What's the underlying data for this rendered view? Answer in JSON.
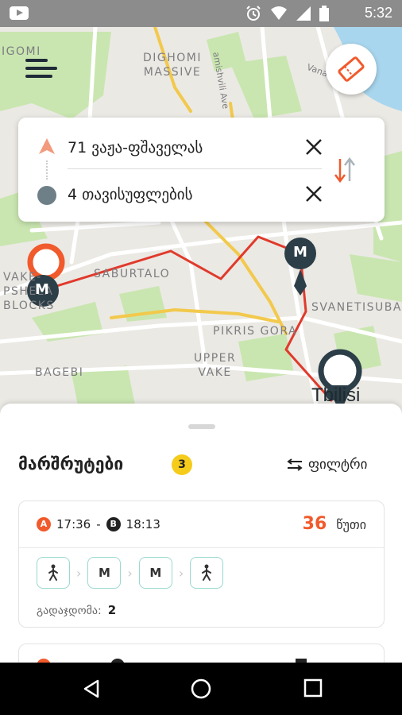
{
  "status_bar": {
    "time": "5:32",
    "icons": [
      "youtube-icon",
      "alarm-icon",
      "wifi-icon",
      "signal-icon",
      "battery-icon"
    ]
  },
  "map": {
    "labels": {
      "digomi_massive": "DIGHOMI\nMASSIVE",
      "digomi": "IGOMI",
      "amishvili_ave": "amishvili Ave",
      "vanati_st": "Vanati St",
      "saburtalo": "SABURTALO",
      "vake_psheli": "VAKE-\nPSHELA\nBLOCKS",
      "vanetisuba": "SVANETISUBA",
      "pikris_gora": "PIKRIS GORA",
      "upper_vake": "UPPER\nVAKE",
      "bagebi": "BAGEBI",
      "tbilisi": "Tbilisi"
    },
    "metro_marker": "M",
    "route_color": "#e03a2c"
  },
  "search": {
    "from": "71 ვაჟა-ფშაველას",
    "to": "4 თავისუფლების"
  },
  "routes_sheet": {
    "title": "მარშრუტები",
    "count": "3",
    "filter_label": "ფილტრი",
    "routes": [
      {
        "start_marker": "A",
        "start_time": "17:36",
        "separator": "-",
        "end_marker": "B",
        "end_time": "18:13",
        "duration": "36",
        "duration_unit": "წუთი",
        "steps": [
          "walk",
          "M",
          "M",
          "walk"
        ],
        "transfers_label": "გადაჯდომა:",
        "transfers": "2"
      }
    ]
  },
  "colors": {
    "accent": "#f15a2c",
    "badge": "#f5cc1b",
    "metro": "#2c3e48",
    "step_border": "#9ad9cf"
  }
}
